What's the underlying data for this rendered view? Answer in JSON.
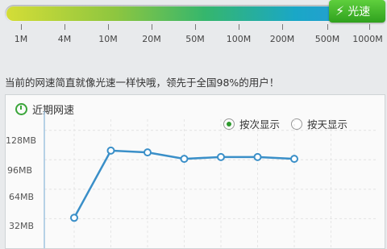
{
  "speed_scale": {
    "fill_fraction": 0.965,
    "badge_label": "光速",
    "ticks": [
      "1M",
      "4M",
      "10M",
      "20M",
      "50M",
      "100M",
      "200M",
      "500M",
      "1000M"
    ]
  },
  "message": "当前的网速简直就像光速一样快哦，领先于全国98%的用户！",
  "panel": {
    "title": "近期网速",
    "radio_options": [
      {
        "label": "按次显示",
        "selected": true
      },
      {
        "label": "按天显示",
        "selected": false
      }
    ]
  },
  "chart_data": {
    "type": "line",
    "y_unit": "MB",
    "yticks": [
      "128MB",
      "96MB",
      "64MB",
      "32MB"
    ],
    "ylim": [
      0,
      140
    ],
    "x": [
      1,
      2,
      3,
      4,
      5,
      6,
      7
    ],
    "values": [
      33,
      106,
      104,
      97,
      99,
      99,
      97
    ],
    "color": "#3a8fc8"
  },
  "colors": {
    "accent_green": "#2fa11e",
    "line": "#3a8fc8"
  }
}
